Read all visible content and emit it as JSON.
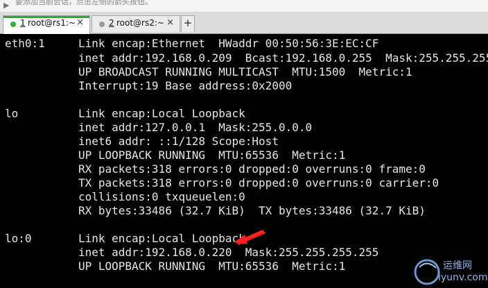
{
  "hintbar": {
    "text": "要添加当前会话，点击左侧的箭头按钮。"
  },
  "tabs": [
    {
      "number": "1",
      "title": "root@rs1:~",
      "dot_color": "#2db52d",
      "active": true
    },
    {
      "number": "2",
      "title": "root@rs2:~",
      "dot_color": "#9a9a9a",
      "active": false
    }
  ],
  "colors": {
    "terminal_bg": "#000000",
    "terminal_fg": "#e6e6e6",
    "active_tab_accent": "#20b020",
    "arrow": "#ff2020"
  },
  "terminal": {
    "lines": [
      "eth0:1     Link encap:Ethernet  HWaddr 00:50:56:3E:EC:CF",
      "           inet addr:192.168.0.209  Bcast:192.168.0.255  Mask:255.255.255.0",
      "           UP BROADCAST RUNNING MULTICAST  MTU:1500  Metric:1",
      "           Interrupt:19 Base address:0x2000",
      "",
      "lo         Link encap:Local Loopback",
      "           inet addr:127.0.0.1  Mask:255.0.0.0",
      "           inet6 addr: ::1/128 Scope:Host",
      "           UP LOOPBACK RUNNING  MTU:65536  Metric:1",
      "           RX packets:318 errors:0 dropped:0 overruns:0 frame:0",
      "           TX packets:318 errors:0 dropped:0 overruns:0 carrier:0",
      "           collisions:0 txqueuelen:0",
      "           RX bytes:33486 (32.7 KiB)  TX bytes:33486 (32.7 KiB)",
      "",
      "lo:0       Link encap:Local Loopback",
      "           inet addr:192.168.0.220  Mask:255.255.255.255",
      "           UP LOOPBACK RUNNING  MTU:65536  Metric:1"
    ]
  },
  "watermark": {
    "cn_text": "运维网",
    "en_text": "iyunv.com"
  }
}
